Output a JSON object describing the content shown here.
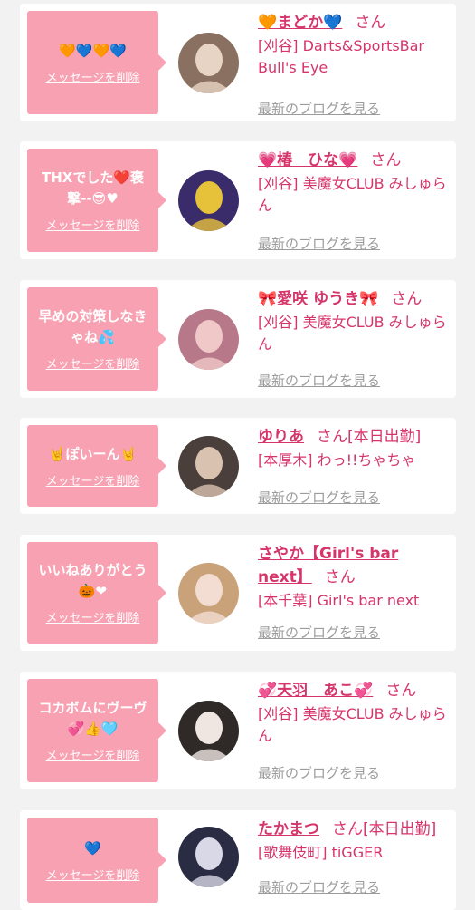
{
  "items": [
    {
      "message": "🧡💙🧡💙",
      "delete_label": "メッセージを削除",
      "name": "🧡まどか💙",
      "honorific": "さん",
      "shop": "[刈谷] Darts&SportsBar Bull's Eye",
      "blog_label": "最新のブログを見る",
      "avatar_colors": [
        "#8a7060",
        "#e8d4c4"
      ],
      "colors": {
        "bubble": "#f8a1b2",
        "name": "#d6356a",
        "link": "#9c9c9c"
      }
    },
    {
      "message": "THXでした❤️褒撃--😎♥",
      "delete_label": "メッセージを削除",
      "name": "💗椿　ひな💗",
      "honorific": "さん",
      "shop": "[刈谷] 美魔女CLUB みしゅらん",
      "blog_label": "最新のブログを見る",
      "avatar_colors": [
        "#3a2b6a",
        "#e6c23a"
      ]
    },
    {
      "message": "早めの対策しなきゃね💦",
      "delete_label": "メッセージを削除",
      "name": "🎀愛咲 ゆうき🎀",
      "honorific": "さん",
      "shop": "[刈谷] 美魔女CLUB みしゅらん",
      "blog_label": "最新のブログを見る",
      "avatar_colors": [
        "#b7798a",
        "#f0c8c8"
      ]
    },
    {
      "message": "🤘ぽいーん🤘",
      "delete_label": "メッセージを削除",
      "name": "ゆりあ",
      "honorific": "さん[本日出勤]",
      "shop": "[本厚木] わっ!!ちゃちゃ",
      "blog_label": "最新のブログを見る",
      "avatar_colors": [
        "#4a3f3a",
        "#d9c2b0"
      ]
    },
    {
      "message": "いいねありがとう🎃❤",
      "delete_label": "メッセージを削除",
      "name": "さやか【Girl's bar next】",
      "honorific": "さん",
      "shop": "[本千葉] Girl's bar next",
      "blog_label": "最新のブログを見る",
      "avatar_colors": [
        "#c9a27a",
        "#f3ddd2"
      ]
    },
    {
      "message": "コカボムにヴーヴ💞👍🩵",
      "delete_label": "メッセージを削除",
      "name": "💞天羽　あこ💞",
      "honorific": "さん",
      "shop": "[刈谷] 美魔女CLUB みしゅらん",
      "blog_label": "最新のブログを見る",
      "avatar_colors": [
        "#2f2a28",
        "#efe6e2"
      ]
    },
    {
      "message": "💙",
      "delete_label": "メッセージを削除",
      "name": "たかまつ",
      "honorific": "さん[本日出勤]",
      "shop": "[歌舞伎町] tiGGER",
      "blog_label": "最新のブログを見る",
      "avatar_colors": [
        "#2a2c44",
        "#d8d8e6"
      ]
    }
  ]
}
